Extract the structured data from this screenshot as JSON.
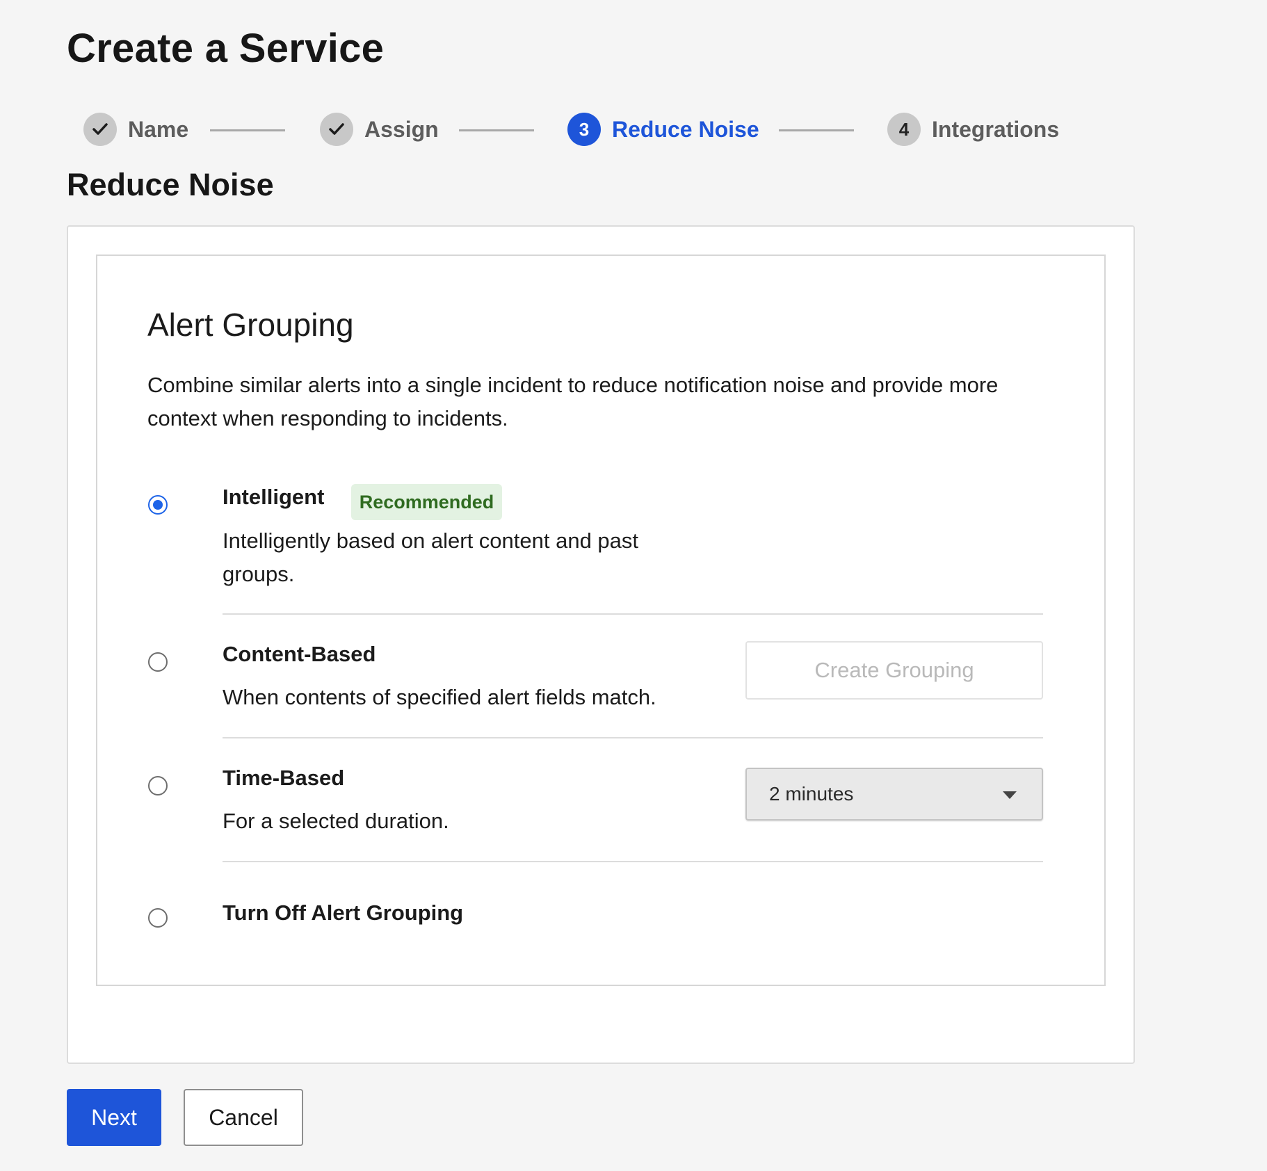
{
  "page": {
    "title": "Create a Service"
  },
  "stepper": {
    "steps": [
      {
        "label": "Name",
        "state": "done",
        "marker": ""
      },
      {
        "label": "Assign",
        "state": "done",
        "marker": ""
      },
      {
        "label": "Reduce Noise",
        "state": "active",
        "marker": "3"
      },
      {
        "label": "Integrations",
        "state": "todo",
        "marker": "4"
      }
    ]
  },
  "section": {
    "title": "Reduce Noise"
  },
  "alert_grouping": {
    "title": "Alert Grouping",
    "description": "Combine similar alerts into a single incident to reduce notification noise and provide more context when responding to incidents.",
    "options": [
      {
        "title": "Intelligent",
        "badge": "Recommended",
        "description": "Intelligently based on alert content and past groups.",
        "selected": true
      },
      {
        "title": "Content-Based",
        "description": "When contents of specified alert fields match.",
        "action_label": "Create Grouping",
        "selected": false
      },
      {
        "title": "Time-Based",
        "description": "For a selected duration.",
        "duration_selected": "2 minutes",
        "selected": false
      },
      {
        "title": "Turn Off Alert Grouping",
        "selected": false
      }
    ]
  },
  "footer": {
    "next_label": "Next",
    "cancel_label": "Cancel"
  },
  "colors": {
    "primary": "#1e55d9",
    "badge_bg": "#e3f2e2",
    "badge_text": "#2f6b20",
    "background": "#f5f5f5"
  }
}
